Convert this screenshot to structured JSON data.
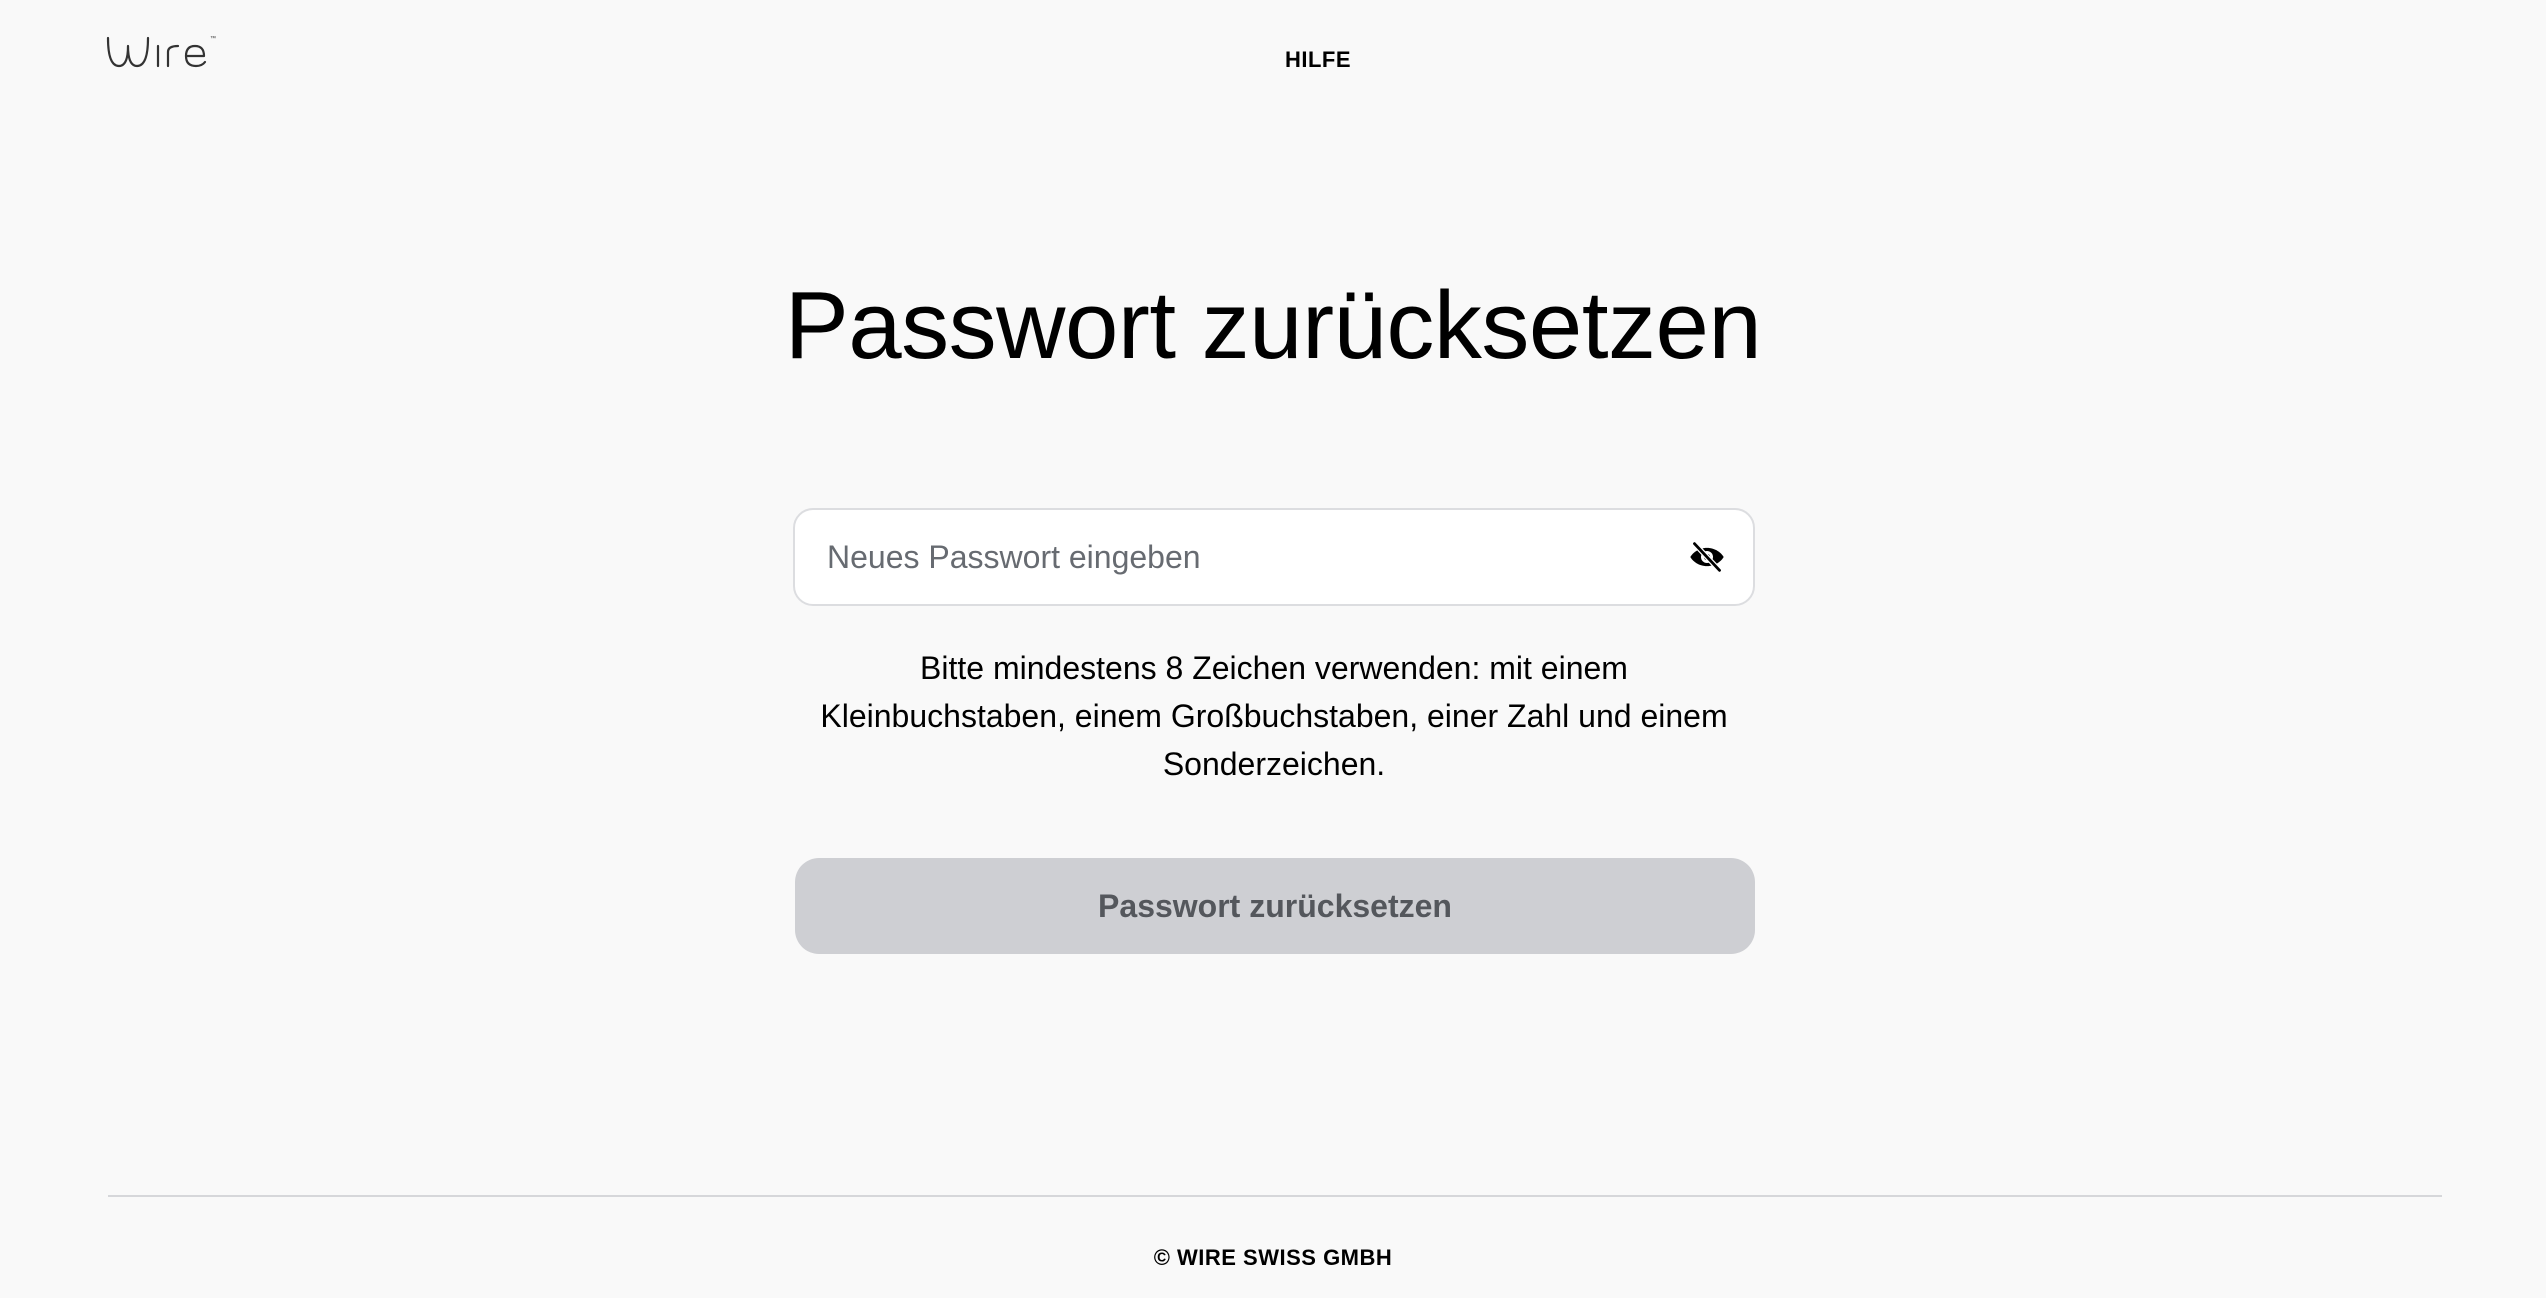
{
  "header": {
    "logo_text": "wire",
    "help_label": "HILFE"
  },
  "main": {
    "title": "Passwort zurücksetzen",
    "password_field": {
      "placeholder": "Neues Passwort eingeben",
      "value": "",
      "toggle_icon": "eye-off-icon"
    },
    "hint": "Bitte mindestens 8 Zeichen verwenden: mit einem Kleinbuchstaben, einem Großbuchstaben, einer Zahl und einem Sonderzeichen.",
    "submit_label": "Passwort zurücksetzen"
  },
  "footer": {
    "copyright": "© WIRE SWISS GMBH"
  },
  "colors": {
    "background": "#f9f9f9",
    "button_disabled_bg": "#cecfd3",
    "button_disabled_text": "#54575c",
    "field_border": "#dcdde0",
    "text": "#000000"
  }
}
